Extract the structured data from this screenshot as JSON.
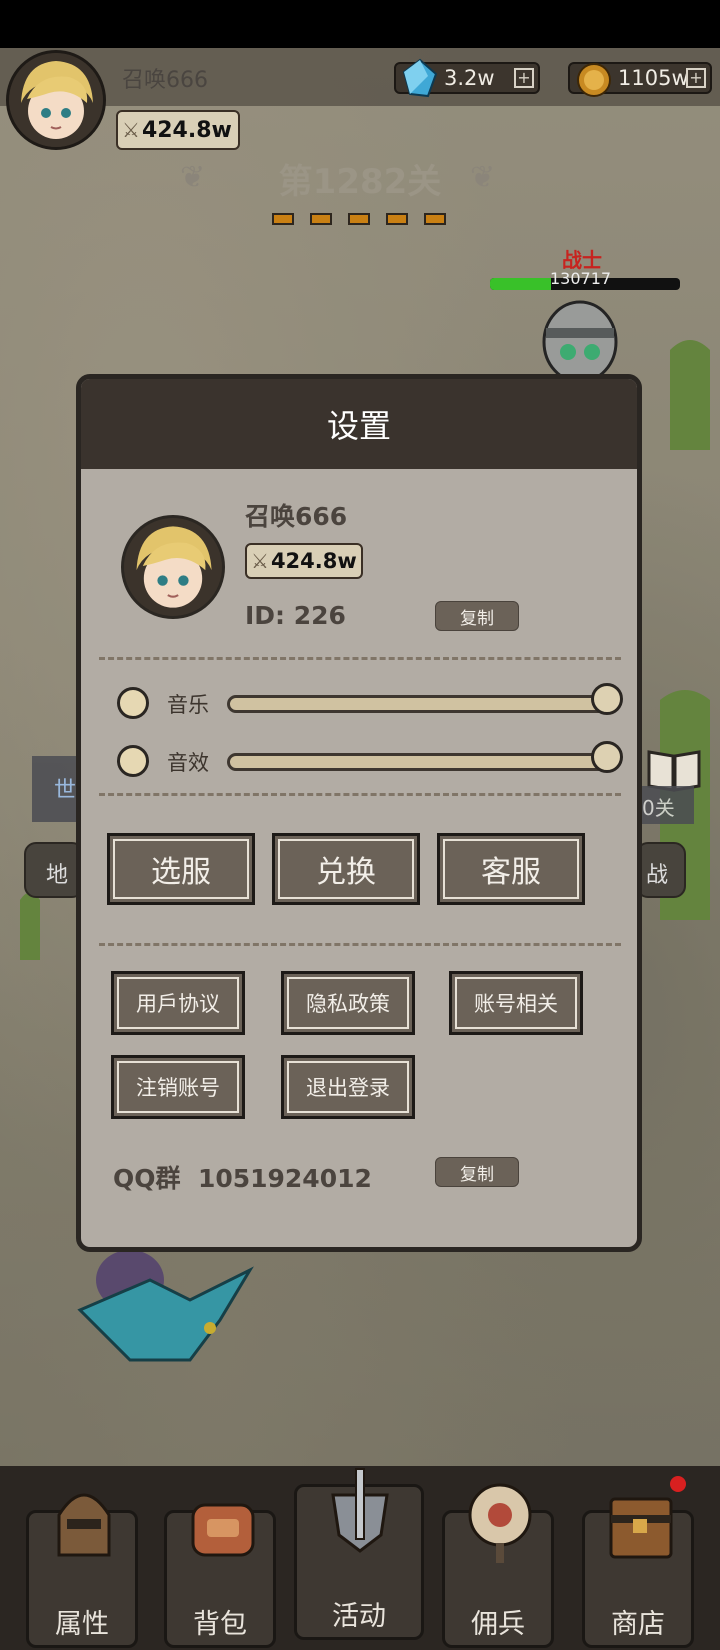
{
  "player": {
    "name": "召唤666",
    "power": "424.8w",
    "id_label": "ID: 226"
  },
  "currency": {
    "gems": "3.2w",
    "coins": "1105w"
  },
  "stage": {
    "title": "第1282关"
  },
  "enemy": {
    "name": "战士",
    "hp": "130717",
    "hp_fraction": 0.32
  },
  "side": {
    "world_chip": "世",
    "land_button": "地",
    "right_chip_text": "0关",
    "right_button": "战"
  },
  "settings": {
    "title": "设置",
    "copy_label": "复制",
    "music_label": "音乐",
    "sfx_label": "音效",
    "music_level": 1.0,
    "sfx_level": 1.0,
    "buttons": {
      "server": "选服",
      "redeem": "兑换",
      "support": "客服"
    },
    "links": {
      "user_agreement": "用戶协议",
      "privacy": "隐私政策",
      "account": "账号相关",
      "delete_account": "注销账号",
      "logout": "退出登录"
    },
    "qq_label": "QQ群",
    "qq_number": "1051924012"
  },
  "nav": [
    {
      "label": "属性",
      "icon": "helmet-icon"
    },
    {
      "label": "背包",
      "icon": "backpack-icon"
    },
    {
      "label": "活动",
      "icon": "sword-shield-icon"
    },
    {
      "label": "佣兵",
      "icon": "target-icon"
    },
    {
      "label": "商店",
      "icon": "chest-icon"
    }
  ],
  "colors": {
    "modal_bg": "#b2aca4",
    "header_bg": "#3a332d",
    "button_bg": "#6b6258",
    "accent_orange": "#c98014",
    "hp_green": "#39c129",
    "enemy_red": "#c7231f"
  }
}
